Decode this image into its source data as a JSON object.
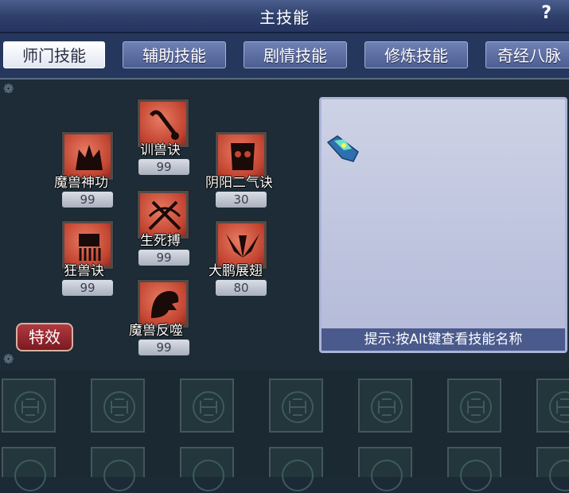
{
  "window": {
    "title": "主技能",
    "help_label": "?"
  },
  "tabs": [
    {
      "label": "师门技能",
      "active": true
    },
    {
      "label": "辅助技能",
      "active": false
    },
    {
      "label": "剧情技能",
      "active": false
    },
    {
      "label": "修炼技能",
      "active": false
    },
    {
      "label": "奇经八脉",
      "active": false
    }
  ],
  "skills": [
    {
      "name": "训兽诀",
      "level": "99",
      "icon": "bone-whip-icon"
    },
    {
      "name": "魔兽神功",
      "level": "99",
      "icon": "beast-crown-icon"
    },
    {
      "name": "阴阳二气诀",
      "level": "30",
      "icon": "yinyang-mask-icon"
    },
    {
      "name": "生死搏",
      "level": "99",
      "icon": "crossed-blades-icon"
    },
    {
      "name": "狂兽诀",
      "level": "99",
      "icon": "beast-skull-icon"
    },
    {
      "name": "大鹏展翅",
      "level": "80",
      "icon": "wings-icon"
    },
    {
      "name": "魔兽反噬",
      "level": "99",
      "icon": "beast-head-icon"
    }
  ],
  "effect_button": {
    "label": "特效"
  },
  "preview": {
    "hint": "提示:按Alt键查看技能名称",
    "icon": "gem-icon"
  },
  "colors": {
    "skill_icon": "#c24431",
    "tab_active": "#ffffff",
    "tab_inactive": "#5a6a9e",
    "effect_button": "#9a2a30"
  }
}
